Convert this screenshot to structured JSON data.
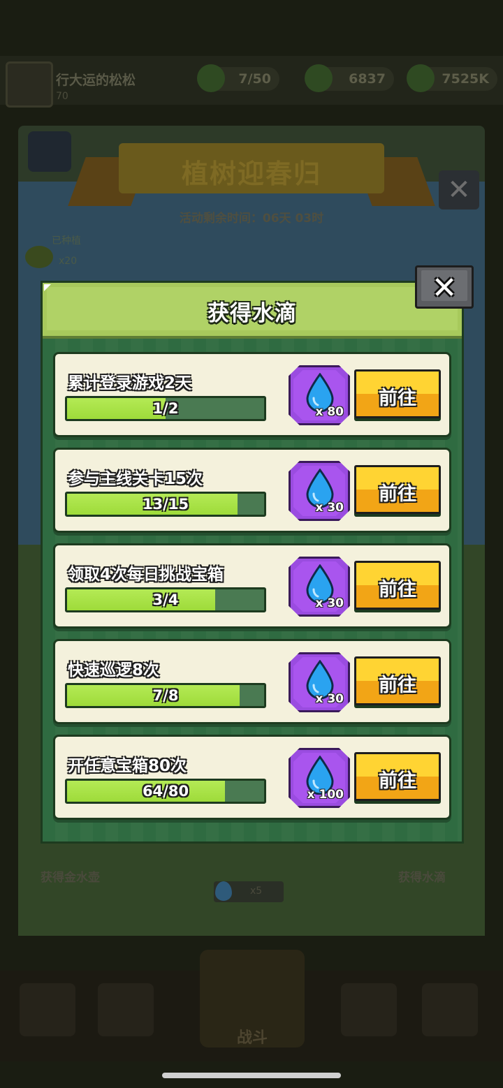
{
  "background": {
    "player_name": "行大运的松松",
    "player_level": "70",
    "resources": [
      {
        "value": "7/50"
      },
      {
        "value": "6837"
      },
      {
        "value": "7525K"
      }
    ],
    "event_title": "植树迎春归",
    "event_timer": "活动剩余时间：06天 03时",
    "planted_label": "已种植",
    "planted_count": "x20",
    "left_action_label": "获得金水壶",
    "right_action_label": "获得水滴",
    "drop_count": "x5",
    "battle_label": "战斗"
  },
  "modal": {
    "title": "获得水滴",
    "close_label": "✕",
    "go_label": "前往",
    "tasks": [
      {
        "name": "累计登录游戏2天",
        "progress_text": "1/2",
        "progress": 0.5,
        "reward": "x 80"
      },
      {
        "name": "参与主线关卡15次",
        "progress_text": "13/15",
        "progress": 0.8667,
        "reward": "x 30"
      },
      {
        "name": "领取4次每日挑战宝箱",
        "progress_text": "3/4",
        "progress": 0.75,
        "reward": "x 30"
      },
      {
        "name": "快速巡逻8次",
        "progress_text": "7/8",
        "progress": 0.875,
        "reward": "x 30"
      },
      {
        "name": "开任意宝箱80次",
        "progress_text": "64/80",
        "progress": 0.8,
        "reward": "x 100"
      }
    ]
  },
  "colors": {
    "modal_bg": "#2f6b41",
    "header_bg": "#b0d266",
    "card_bg": "#f4f1dc",
    "progress_fill": "#a8e34a",
    "reward_purple": "#a955ee",
    "button_yellow": "#ffd433"
  }
}
